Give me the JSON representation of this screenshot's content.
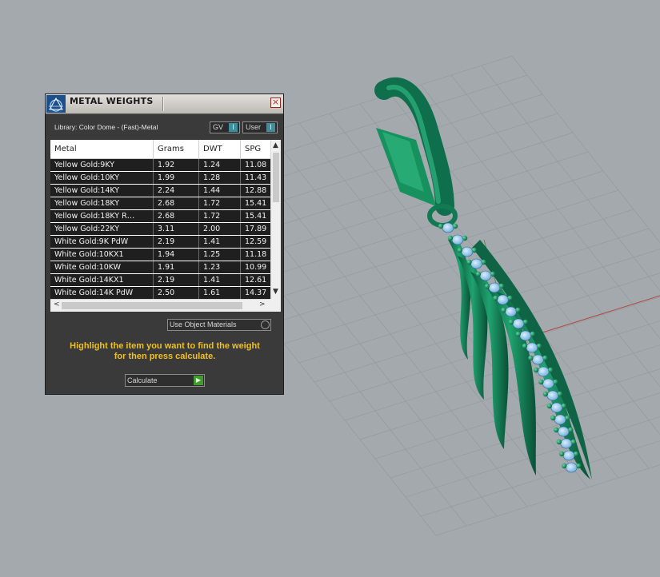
{
  "panel": {
    "title": "METAL WEIGHTS",
    "close_icon": "×",
    "library_label": "Library: Color Dome - (Fast)-Metal",
    "gv_toggle": {
      "label": "GV",
      "icon": "toggle-switch-icon"
    },
    "user_toggle": {
      "label": "User",
      "icon": "toggle-switch-icon"
    },
    "table": {
      "columns": [
        "Metal",
        "Grams",
        "DWT",
        "SPG"
      ],
      "rows": [
        [
          "Yellow Gold:9KY",
          "1.92",
          "1.24",
          "11.08"
        ],
        [
          "Yellow Gold:10KY",
          "1.99",
          "1.28",
          "11.43"
        ],
        [
          "Yellow Gold:14KY",
          "2.24",
          "1.44",
          "12.88"
        ],
        [
          "Yellow Gold:18KY",
          "2.68",
          "1.72",
          "15.41"
        ],
        [
          "Yellow Gold:18KY R…",
          "2.68",
          "1.72",
          "15.41"
        ],
        [
          "Yellow Gold:22KY",
          "3.11",
          "2.00",
          "17.89"
        ],
        [
          "White Gold:9K PdW",
          "2.19",
          "1.41",
          "12.59"
        ],
        [
          "White Gold:10KX1",
          "1.94",
          "1.25",
          "11.18"
        ],
        [
          "White Gold:10KW",
          "1.91",
          "1.23",
          "10.99"
        ],
        [
          "White Gold:14KX1",
          "2.19",
          "1.41",
          "12.61"
        ],
        [
          "White Gold:14K PdW",
          "2.50",
          "1.61",
          "14.37"
        ]
      ],
      "scroll_up": "▲",
      "scroll_down": "▼",
      "scroll_left": "<",
      "scroll_right": ">"
    },
    "use_object_materials": "Use Object Materials",
    "instruction_line1": "Highlight the item you want to find the weight",
    "instruction_line2": "for then press calculate.",
    "calculate_label": "Calculate",
    "calculate_icon": "play-arrow-icon",
    "accent_color": "#f0c020",
    "toggle_color": "#3d8fa0",
    "go_color": "#3f9b2e"
  },
  "viewport": {
    "background": "#a4a9ad",
    "model": "earring-3d-model",
    "grid": "perspective-grid"
  }
}
